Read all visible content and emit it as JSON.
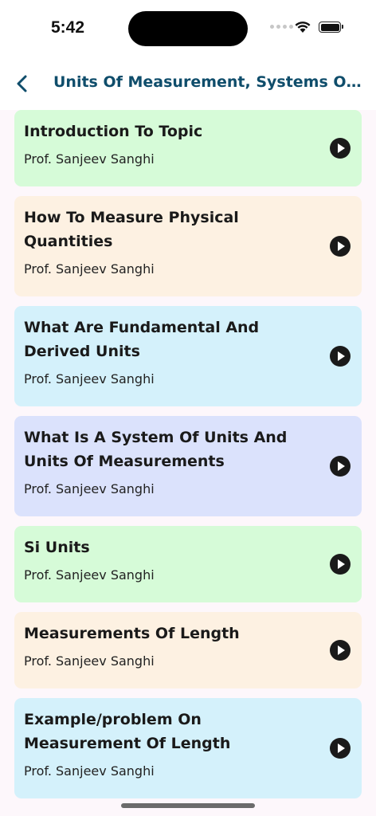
{
  "status_bar": {
    "time": "5:42"
  },
  "header": {
    "title": "Units Of Measurement, Systems Of ..."
  },
  "colors": {
    "green": "#d6fbd8",
    "peach": "#fdf1e2",
    "blue": "#d4f1fb",
    "lavender": "#dbe2fc",
    "title": "#0f4d6b"
  },
  "lectures": [
    {
      "title": "Introduction To Topic",
      "author": "Prof. Sanjeev Sanghi",
      "color": "green"
    },
    {
      "title": "How To Measure Physical Quantities",
      "author": "Prof. Sanjeev Sanghi",
      "color": "peach"
    },
    {
      "title": "What Are Fundamental And Derived Units",
      "author": "Prof. Sanjeev Sanghi",
      "color": "blue"
    },
    {
      "title": "What Is A System Of Units And Units Of Measurements",
      "author": "Prof. Sanjeev Sanghi",
      "color": "lavender"
    },
    {
      "title": "Si Units",
      "author": "Prof. Sanjeev Sanghi",
      "color": "green"
    },
    {
      "title": "Measurements Of Length",
      "author": "Prof. Sanjeev Sanghi",
      "color": "peach"
    },
    {
      "title": "Example/problem On Measurement Of Length",
      "author": "Prof. Sanjeev Sanghi",
      "color": "blue"
    }
  ]
}
